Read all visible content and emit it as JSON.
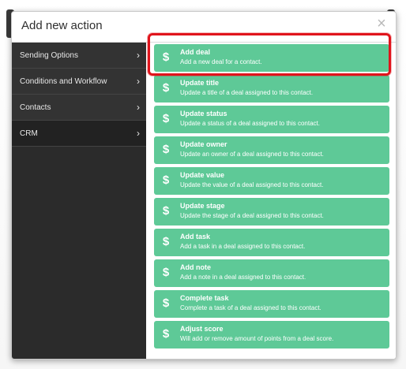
{
  "dialog": {
    "title": "Add new action",
    "close_label": "×"
  },
  "sidebar": {
    "items": [
      {
        "label": "Sending Options",
        "chevron": "›"
      },
      {
        "label": "Conditions and Workflow",
        "chevron": "›"
      },
      {
        "label": "Contacts",
        "chevron": "›"
      },
      {
        "label": "CRM",
        "chevron": "›"
      }
    ]
  },
  "actions": [
    {
      "icon": "$",
      "title": "Add deal",
      "desc": "Add a new deal for a contact."
    },
    {
      "icon": "$",
      "title": "Update title",
      "desc": "Update a title of a deal assigned to this contact."
    },
    {
      "icon": "$",
      "title": "Update status",
      "desc": "Update a status of a deal assigned to this contact."
    },
    {
      "icon": "$",
      "title": "Update owner",
      "desc": "Update an owner of a deal assigned to this contact."
    },
    {
      "icon": "$",
      "title": "Update value",
      "desc": "Update the value of a deal assigned to this contact."
    },
    {
      "icon": "$",
      "title": "Update stage",
      "desc": "Update the stage of a deal assigned to this contact."
    },
    {
      "icon": "$",
      "title": "Add task",
      "desc": "Add a task in a deal assigned to this contact."
    },
    {
      "icon": "$",
      "title": "Add note",
      "desc": "Add a note in a deal assigned to this contact."
    },
    {
      "icon": "$",
      "title": "Complete task",
      "desc": "Complete a task of a deal assigned to this contact."
    },
    {
      "icon": "$",
      "title": "Adjust score",
      "desc": "Will add or remove amount of points from a deal score."
    }
  ],
  "colors": {
    "action_bg": "#5ec997",
    "sidebar_bg": "#2b2b2b",
    "highlight": "#e0141c"
  },
  "icons": {
    "action_icon": "dollar-icon",
    "close_icon": "close-icon",
    "chevron_icon": "chevron-right-icon"
  }
}
